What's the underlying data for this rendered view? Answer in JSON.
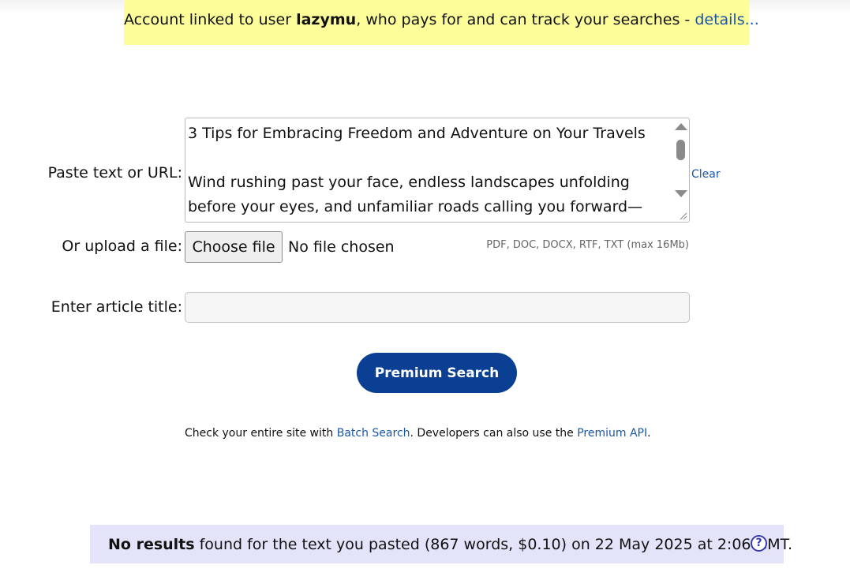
{
  "notice": {
    "prefix": "Account linked to user ",
    "username": "lazymu",
    "suffix": ", who pays for and can track your searches - ",
    "details_link": "details..."
  },
  "form": {
    "text_label": "Paste text or URL:",
    "text_content_title": "3 Tips for Embracing Freedom and Adventure on Your Travels",
    "text_content_body": "Wind rushing past your face, endless landscapes unfolding before your eyes, and unfamiliar roads calling you forward—these are the",
    "clear_link": "Clear",
    "upload_label": "Or upload a file:",
    "choose_file_button": "Choose file",
    "file_status": "No file chosen",
    "file_hint": "PDF, DOC, DOCX, RTF, TXT (max 16Mb)",
    "title_label": "Enter article title:",
    "title_value": "",
    "search_button": "Premium Search"
  },
  "info": {
    "text1": "Check your entire site with ",
    "batch_link": "Batch Search",
    "text2": ". Developers can also use the ",
    "api_link": "Premium API",
    "text3": "."
  },
  "result": {
    "bold": "No results",
    "text": " found for the text you pasted (867 words, $0.10) on 22 May 2025 at 2:06 GMT.",
    "help_icon": "?"
  }
}
